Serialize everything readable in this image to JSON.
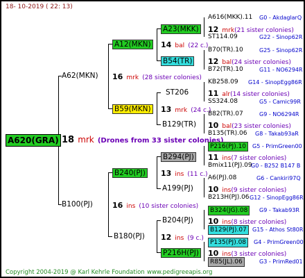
{
  "header": {
    "date": "18- 10-2019 ( 22: 13)"
  },
  "root": {
    "id": "A620(GRA)",
    "num": "18",
    "abbr": "mrk",
    "note": "(Drones from 33 sister colonies)"
  },
  "gen1": [
    {
      "id": "A62(MKN)",
      "num": "16",
      "abbr": "mrk",
      "note": "(28 sister colonies)"
    },
    {
      "id": "B100(PJ)",
      "num": "16",
      "abbr": "ins",
      "note": "(10 sister colonies)"
    }
  ],
  "gen2": [
    {
      "id": "A12(MKN)",
      "num": "14",
      "abbr": "bal",
      "note": "(22 c.)"
    },
    {
      "id": "B59(MKN)",
      "num": "13",
      "abbr": "mrk",
      "note": "(24 c.)"
    },
    {
      "id": "B240(PJ)",
      "num": "13",
      "abbr": "ins",
      "note": "(11 c.)"
    },
    {
      "id": "B180(PJ)",
      "num": "12",
      "abbr": "ins",
      "note": "(9 c.)"
    }
  ],
  "gen3": [
    {
      "id": "A23(MKK)",
      "num": "12",
      "abbr": "mrk",
      "note": "(21 sister colonies)"
    },
    {
      "id": "B54(TR)",
      "num": "12",
      "abbr": "bal",
      "note": "(24 sister colonies)"
    },
    {
      "id": "ST206",
      "num": "11",
      "abbr": "alr",
      "note": "(14 sister colonies)"
    },
    {
      "id": "B129(TR)",
      "num": "10",
      "abbr": "bal",
      "note": "(23 sister colonies)"
    },
    {
      "id": "B294(PJ)",
      "num": "11",
      "abbr": "ins",
      "note": "(7 sister colonies)"
    },
    {
      "id": "A199(PJ)",
      "num": "10",
      "abbr": "ins",
      "note": "(9 sister colonies)"
    },
    {
      "id": "B204(PJ)",
      "num": "10",
      "abbr": "ins",
      "note": "(8 sister colonies)"
    },
    {
      "id": "P216H(PJ)",
      "num": "10",
      "abbr": "ins",
      "note": "(3 sister colonies)"
    }
  ],
  "gen4": [
    {
      "id": "A616(MKK).11",
      "ref": "G0 - AkdaglarQ"
    },
    {
      "id": "ST114.09",
      "ref": "G22 - Sinop62R"
    },
    {
      "id": "B70(TR).10",
      "ref": "G25 - Sinop62R"
    },
    {
      "id": "B72(TR).10",
      "ref": "G11 - NO6294R"
    },
    {
      "id": "KB258.09",
      "ref": "G14 - SinopEgg86R"
    },
    {
      "id": "SS324.08",
      "ref": "G5 - Camic99R"
    },
    {
      "id": "B82(TR).07",
      "ref": "G9 - NO6294R"
    },
    {
      "id": "B135(TR).06",
      "ref": "G8 - Takab93aR"
    },
    {
      "id": "P216(PJ).10",
      "ref": "G5 - PrimGreen00"
    },
    {
      "id": "Bmix11(PJ).09",
      "ref": "G0 - B252 B147 B"
    },
    {
      "id": "A6(PJ).08",
      "ref": "G6 - Cankiri97Q"
    },
    {
      "id": "B213H(PJ).06",
      "ref": "G12 - SinopEgg86R"
    },
    {
      "id": "B324(JG).08",
      "ref": "G9 - Takab93R"
    },
    {
      "id": "B129(PJ).07",
      "ref": "G15 - Athos St80R"
    },
    {
      "id": "P135(PJ).08",
      "ref": "G4 - PrimGreen00"
    },
    {
      "id": "R85(JL).06",
      "ref": "G3 - PrimRed01"
    }
  ],
  "footer": {
    "copyright": "Copyright 2004-2019 @ Karl Kehrle Foundation",
    "url": "www.pedigreeapis.org"
  }
}
